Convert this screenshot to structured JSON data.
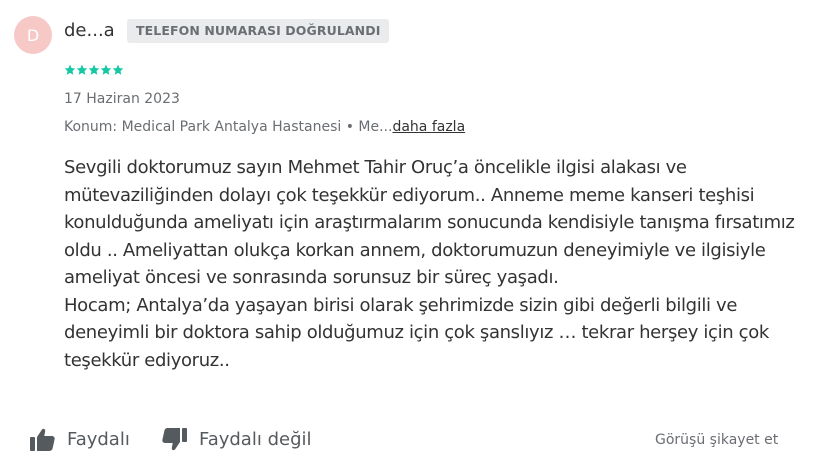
{
  "reviewer": {
    "avatar_letter": "D",
    "avatar_color": "#f6c9c7",
    "username": "de...a",
    "badge": "TELEFON NUMARASI DOĞRULANDI"
  },
  "rating": {
    "stars": 5,
    "max": 5,
    "color": "#14c8a4"
  },
  "date": "17 Haziran 2023",
  "location": {
    "text": "Konum: Medical Park Antalya Hastanesi • Me...",
    "more_link": "daha fazla"
  },
  "review": {
    "paragraphs": [
      "Sevgili doktorumuz sayın Mehmet Tahir Oruç’a öncelikle ilgisi alakası ve mütevaziliğinden dolayı çok teşekkür ediyorum.. Anneme meme kanseri teşhisi konulduğunda ameliyatı için araştırmalarım sonucunda kendisiyle tanışma fırsatımız oldu .. Ameliyattan olukça korkan annem, doktorumuzun deneyimiyle ve ilgisiyle ameliyat öncesi ve sonrasında sorunsuz bir süreç yaşadı.",
      "Hocam; Antalya’da yaşayan birisi olarak şehrimizde sizin gibi değerli bilgili ve deneyimli bir doktora sahip olduğumuz için çok şanslıyız … tekrar herşey için çok teşekkür ediyoruz.."
    ]
  },
  "actions": {
    "helpful": {
      "label": "Faydalı",
      "icon": "thumbs-up-icon"
    },
    "not_helpful": {
      "label": "Faydalı değil",
      "icon": "thumbs-down-icon"
    },
    "report": "Görüşü şikayet et"
  }
}
